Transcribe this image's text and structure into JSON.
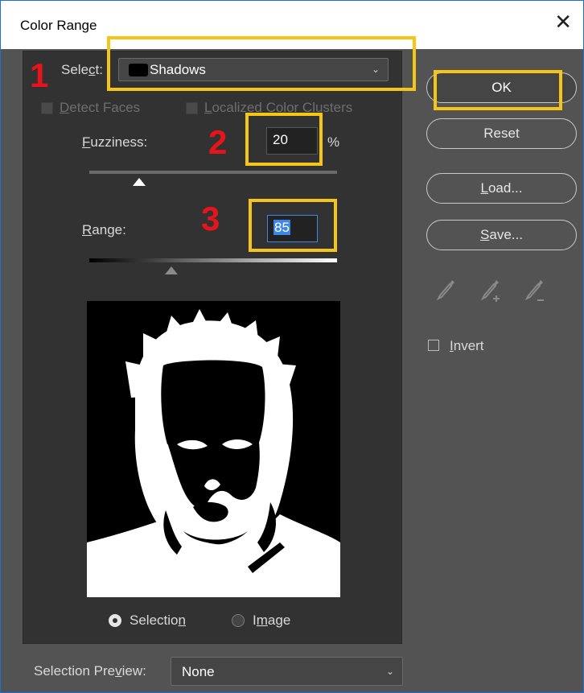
{
  "window": {
    "title": "Color Range",
    "close_glyph": "✕"
  },
  "select_row": {
    "label_prefix": "Sele",
    "label_mnemonic": "c",
    "label_suffix": "t:",
    "value": "Shadows",
    "swatch_color": "#000000"
  },
  "options": {
    "detect_faces": {
      "prefix": "",
      "mnemonic": "D",
      "suffix": "etect Faces",
      "checked": false,
      "enabled": false
    },
    "localized": {
      "prefix": "",
      "mnemonic": "L",
      "suffix": "ocalized Color Clusters",
      "checked": false,
      "enabled": false
    }
  },
  "fuzziness": {
    "prefix": "",
    "mnemonic": "F",
    "suffix": "uzziness:",
    "value": "20",
    "unit": "%",
    "slider_fraction": 0.2
  },
  "range": {
    "prefix": "",
    "mnemonic": "R",
    "suffix": "ange:",
    "value": "85",
    "slider_fraction": 0.33
  },
  "view_mode": {
    "selection": {
      "prefix": "Selectio",
      "mnemonic": "n",
      "suffix": "",
      "selected": true
    },
    "image": {
      "prefix": "I",
      "mnemonic": "m",
      "suffix": "age",
      "selected": false
    }
  },
  "selection_preview": {
    "prefix": "Selection Pre",
    "mnemonic": "v",
    "suffix": "iew:",
    "value": "None"
  },
  "buttons": {
    "ok": "OK",
    "reset": "Reset",
    "load": {
      "mnemonic": "L",
      "rest": "oad..."
    },
    "save": {
      "mnemonic": "S",
      "rest": "ave..."
    }
  },
  "invert": {
    "prefix": "",
    "mnemonic": "I",
    "suffix": "nvert",
    "checked": false
  },
  "annotations": {
    "step1": "1",
    "step2": "2",
    "step3": "3",
    "color": "#f5c518",
    "number_color": "#e8141b"
  },
  "icons": [
    "eyedropper-icon",
    "eyedropper-plus-icon",
    "eyedropper-minus-icon",
    "chevron-down-icon",
    "close-icon"
  ]
}
